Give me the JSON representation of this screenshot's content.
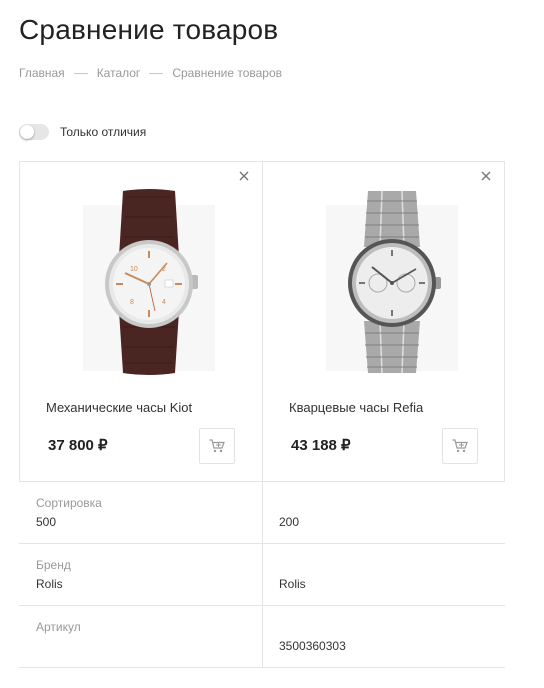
{
  "page": {
    "title": "Сравнение товаров"
  },
  "breadcrumb": [
    "Главная",
    "Каталог",
    "Сравнение товаров"
  ],
  "filter": {
    "label": "Только отличия",
    "enabled": false
  },
  "products": [
    {
      "name": "Механические часы Kiot",
      "price": "37 800 ₽",
      "image": "watch-leather-strap-icon"
    },
    {
      "name": "Кварцевые часы Refia",
      "price": "43 188 ₽",
      "image": "watch-metal-bracelet-icon"
    }
  ],
  "properties": [
    {
      "label": "Сортировка",
      "values": [
        "500",
        "200"
      ]
    },
    {
      "label": "Бренд",
      "values": [
        "Rolis",
        "Rolis"
      ]
    },
    {
      "label": "Артикул",
      "values": [
        "",
        "3500360303"
      ]
    }
  ],
  "colors": {
    "text": "#333333",
    "muted": "#999999",
    "border": "#e5e5e5",
    "toggle_off": "#e6e6e6"
  }
}
